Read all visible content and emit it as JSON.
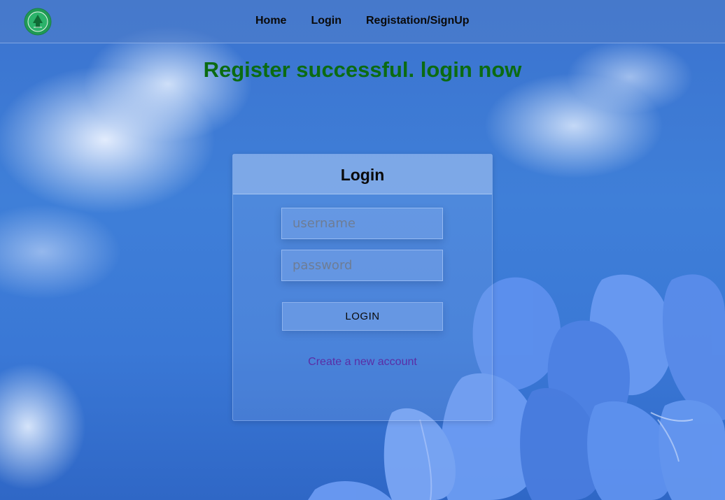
{
  "nav": {
    "logo_icon": "university-seal-icon",
    "links": [
      {
        "label": "Home"
      },
      {
        "label": "Login"
      },
      {
        "label": "Registation/SignUp"
      }
    ]
  },
  "banner": {
    "message": "Register successful. login now",
    "color": "#0b6b12"
  },
  "login_card": {
    "title": "Login",
    "username": {
      "value": "",
      "placeholder": "username"
    },
    "password": {
      "value": "",
      "placeholder": "password"
    },
    "submit_label": "LOGIN",
    "create_account_label": "Create a new account"
  },
  "colors": {
    "sky": "#3b78d6",
    "link": "#5a2ea6",
    "flower": "#5b8eec"
  }
}
